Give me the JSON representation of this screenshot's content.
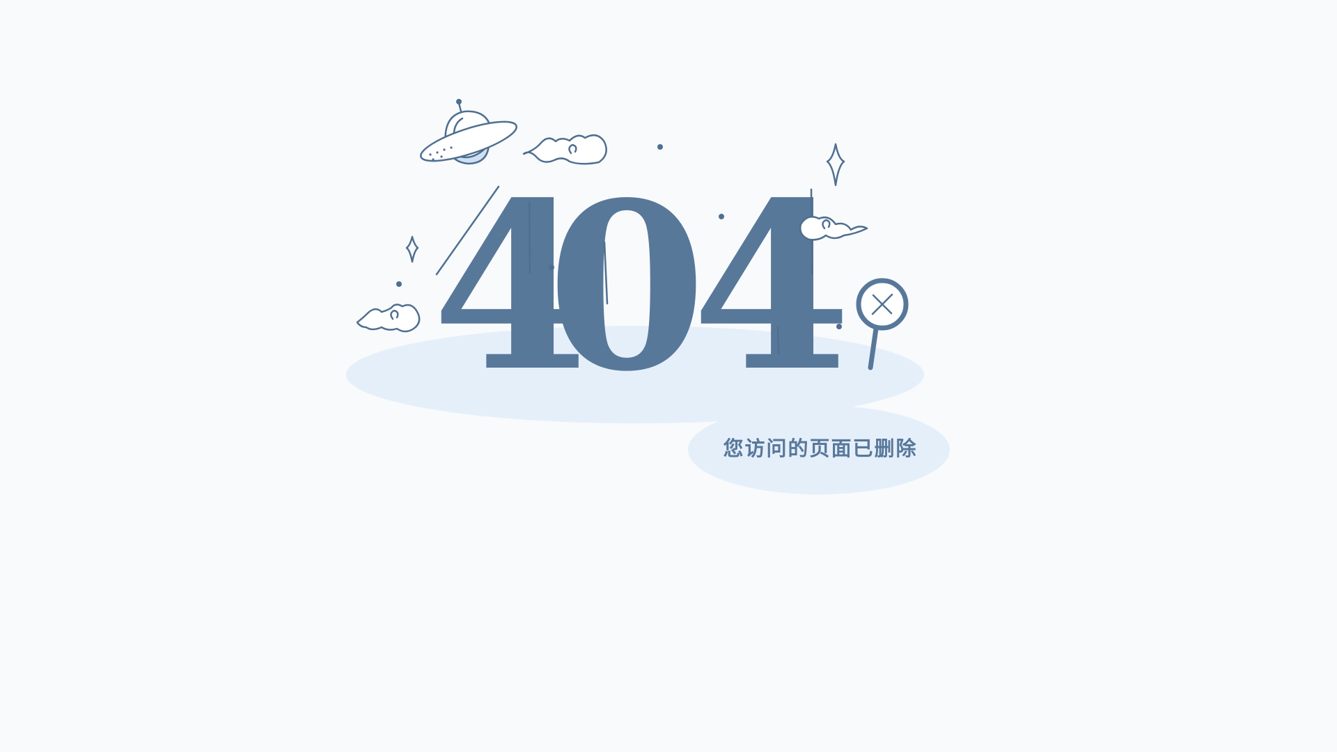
{
  "error": {
    "code_digits": [
      "4",
      "0",
      "4"
    ],
    "message": "您访问的页面已删除"
  },
  "colors": {
    "background": "#f8fafc",
    "accent": "#58789a",
    "outline": "#4f6f90",
    "platform": "#e5effa",
    "ufo_belly": "#cfe0f5"
  },
  "icons": {
    "ufo": "ufo-icon",
    "cloud": "cloud-icon",
    "sparkle": "sparkle-icon",
    "sign": "x-sign-icon"
  }
}
